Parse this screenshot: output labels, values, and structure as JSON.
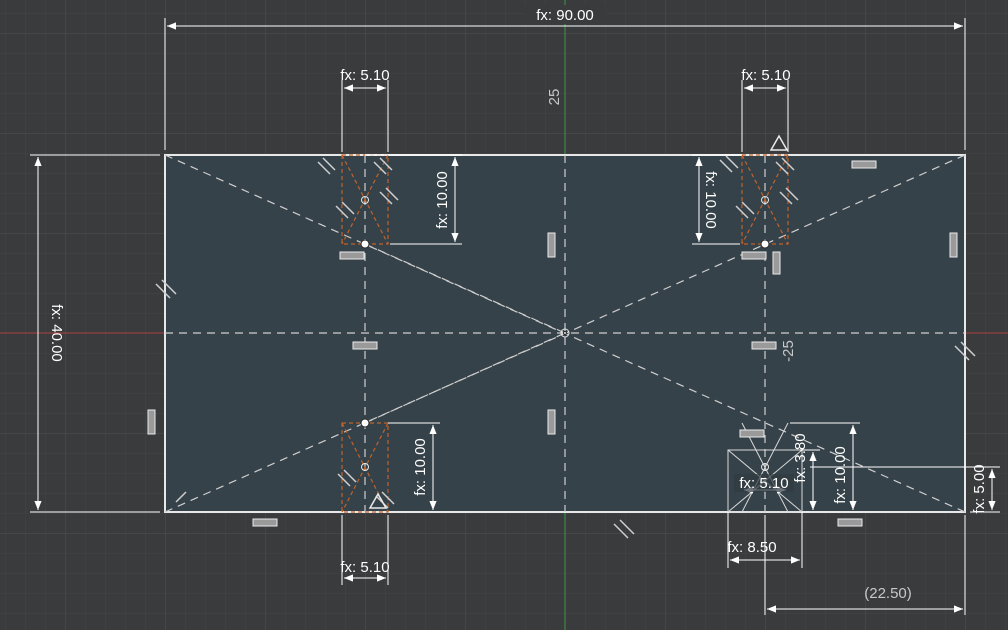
{
  "sketch": {
    "top_width": "fx: 90.00",
    "left_height": "fx: 40.00",
    "slot_top_left_width": "fx: 5.10",
    "slot_top_right_width": "fx: 5.10",
    "slot_bottom_left_width": "fx: 5.10",
    "slot_top_left_height": "fx: 10.00",
    "slot_top_right_height": "fx: 10.00",
    "slot_bottom_left_height": "fx: 10.00",
    "slot_bottom_right_height": "fx: 10.00",
    "slot_bottom_right_width": "fx: 5.10",
    "small_dim_3_80": "fx: 3.80",
    "right_edge_5_00": "fx: 5.00",
    "bottom_8_50": "fx: 8.50",
    "offset_top": "25",
    "offset_right": "-25",
    "ref_22_50": "(22.50)"
  },
  "colors": {
    "background": "#3a3b3d",
    "grid": "#4a4b4e",
    "fill": "#36424a",
    "edge": "#e8e8e8",
    "dash": "#cfcfcf",
    "axis_y": "#3f9a3f",
    "axis_x": "#b04040",
    "slot": "#c0622a"
  }
}
